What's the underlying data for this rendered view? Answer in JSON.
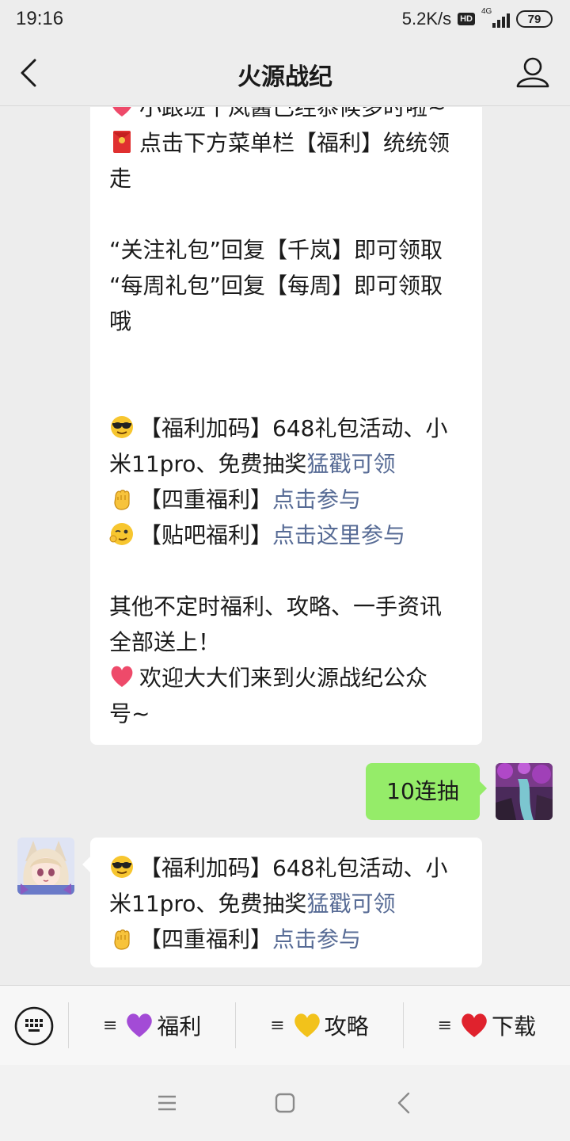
{
  "status_bar": {
    "time": "19:16",
    "speed": "5.2K/s",
    "hd": "HD",
    "network": "4G",
    "battery": "79"
  },
  "header": {
    "title": "火源战纪"
  },
  "messages": {
    "first": {
      "lines": [
        {
          "emoji": "heart-icon",
          "text": "小跟班千岚酱已经恭候多时啦~"
        },
        {
          "emoji": "red-envelope-icon",
          "text": "点击下方菜单栏【福利】统统领"
        },
        {
          "text": "走"
        },
        {
          "text": ""
        },
        {
          "text": "“关注礼包”回复【千岚】即可领取"
        },
        {
          "text": "“每周礼包”回复【每周】即可领取"
        },
        {
          "text": "哦"
        },
        {
          "text": ""
        },
        {
          "text": ""
        },
        {
          "emoji": "sunglasses-emoji",
          "text": "【福利加码】648礼包活动、小"
        },
        {
          "text": "米11pro、免费抽奖",
          "link": "猛戳可领"
        },
        {
          "emoji": "fist-emoji",
          "text": "【四重福利】",
          "link": "点击参与"
        },
        {
          "emoji": "wink-emoji",
          "text": "【贴吧福利】",
          "link": "点击这里参与"
        },
        {
          "text": ""
        },
        {
          "text": "其他不定时福利、攻略、一手资讯"
        },
        {
          "text": "全部送上！"
        },
        {
          "emoji": "heart-icon",
          "text": "欢迎大大们来到火源战纪公众"
        },
        {
          "text": "号~"
        }
      ]
    },
    "sent": {
      "text": "10连抽"
    },
    "reply": {
      "lines": [
        {
          "emoji": "sunglasses-emoji",
          "text": "【福利加码】648礼包活动、小"
        },
        {
          "text": "米11pro、免费抽奖",
          "link": "猛戳可领"
        },
        {
          "emoji": "fist-emoji",
          "text": "【四重福利】",
          "link": "点击参与"
        }
      ]
    }
  },
  "menu": {
    "items": [
      {
        "icon": "purple-heart-icon",
        "label": "福利",
        "color": "#a34bd6"
      },
      {
        "icon": "yellow-heart-icon",
        "label": "攻略",
        "color": "#f2c21b"
      },
      {
        "icon": "red-heart-icon",
        "label": "下载",
        "color": "#e0222d"
      }
    ]
  },
  "colors": {
    "link": "#576b95",
    "sent_bubble": "#95ec69",
    "background": "#ededed"
  }
}
